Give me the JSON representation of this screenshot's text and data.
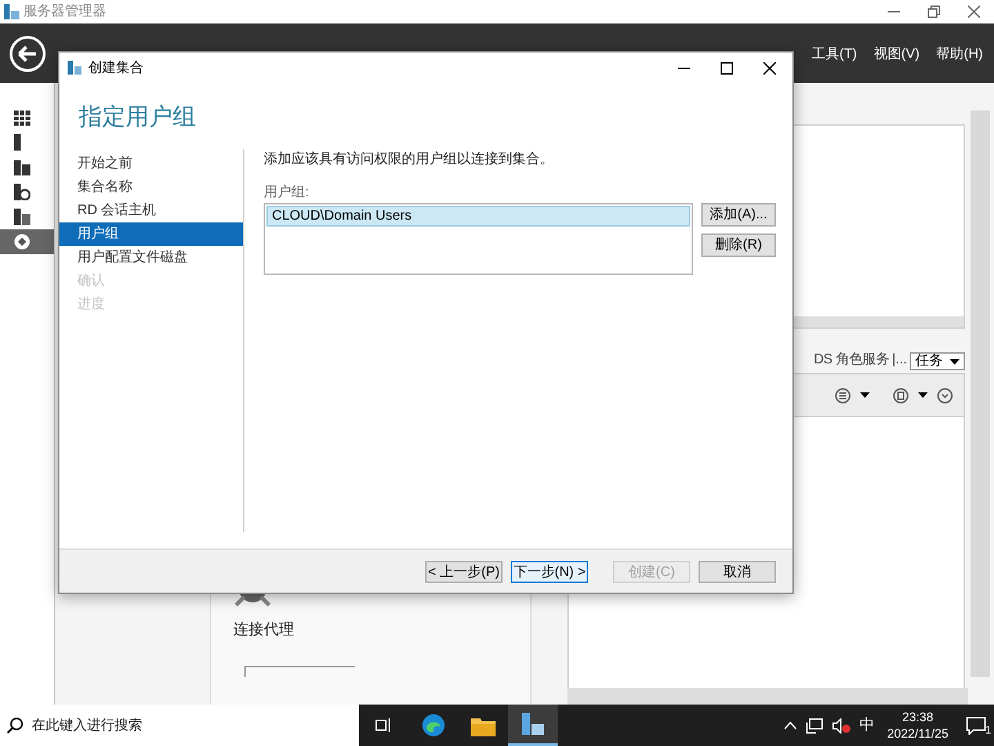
{
  "window": {
    "title": "服务器管理器"
  },
  "menu": [
    "工具(T)",
    "视图(V)",
    "帮助(H)"
  ],
  "sidebar": {
    "items": [
      {
        "kind": "dashboard",
        "selected": false
      },
      {
        "kind": "server",
        "selected": false
      },
      {
        "kind": "servers",
        "selected": false
      },
      {
        "kind": "file",
        "selected": false
      },
      {
        "kind": "storage",
        "selected": false
      },
      {
        "kind": "remote",
        "selected": true
      }
    ]
  },
  "dialog": {
    "title": "创建集合",
    "heading": "指定用户组",
    "steps": [
      {
        "label": "开始之前",
        "selected": false,
        "disabled": false
      },
      {
        "label": "集合名称",
        "selected": false,
        "disabled": false
      },
      {
        "label": "RD 会话主机",
        "selected": false,
        "disabled": false
      },
      {
        "label": "用户组",
        "selected": true,
        "disabled": false
      },
      {
        "label": "用户配置文件磁盘",
        "selected": false,
        "disabled": false
      },
      {
        "label": "确认",
        "selected": false,
        "disabled": true
      },
      {
        "label": "进度",
        "selected": false,
        "disabled": true
      }
    ],
    "description": "添加应该具有访问权限的用户组以连接到集合。",
    "list_label": "用户组:",
    "list_items": [
      {
        "label": "CLOUD\\Domain Users",
        "selected": true
      }
    ],
    "side_buttons": [
      "添加(A)...",
      "删除(R)"
    ],
    "footer_buttons": [
      {
        "label": "< 上一步(P)",
        "disabled": false,
        "focused": false
      },
      {
        "label": "下一步(N) >",
        "disabled": false,
        "focused": true
      },
      {
        "label": "创建(C)",
        "disabled": true,
        "focused": false
      },
      {
        "label": "取消",
        "disabled": false,
        "focused": false
      }
    ]
  },
  "background": {
    "roles_label": "DS 角色服务",
    "roles_more": "|...",
    "tasks_dropdown": "任务",
    "broker_label": "连接代理"
  },
  "taskbar": {
    "search_placeholder": "在此键入进行搜索",
    "ime": "中",
    "time": "23:38",
    "date": "2022/11/25",
    "notification_count": "1"
  }
}
